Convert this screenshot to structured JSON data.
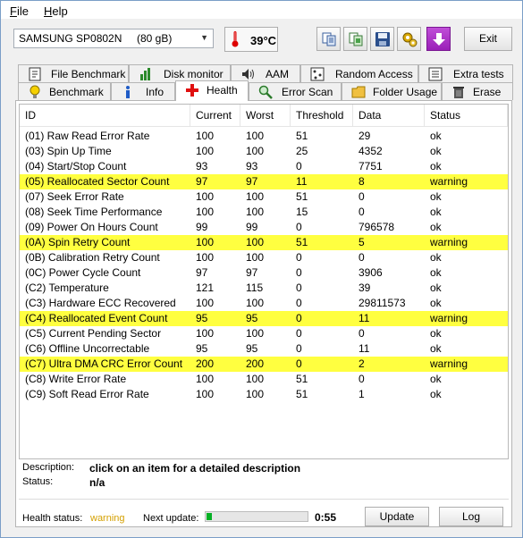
{
  "menu": {
    "file": "File",
    "help": "Help"
  },
  "toolbar": {
    "drive_name": "SAMSUNG SP0802N",
    "drive_size": "(80 gB)",
    "temperature": "39°C",
    "exit_label": "Exit"
  },
  "tabs_top": [
    "File Benchmark",
    "Disk monitor",
    "AAM",
    "Random Access",
    "Extra tests"
  ],
  "tabs_bottom": [
    "Benchmark",
    "Info",
    "Health",
    "Error Scan",
    "Folder Usage",
    "Erase"
  ],
  "active_tab": "Health",
  "table": {
    "headers": [
      "ID",
      "Current",
      "Worst",
      "Threshold",
      "Data",
      "Status"
    ],
    "rows": [
      {
        "id": "(01) Raw Read Error Rate",
        "current": "100",
        "worst": "100",
        "threshold": "51",
        "data": "29",
        "status": "ok",
        "warn": false
      },
      {
        "id": "(03) Spin Up Time",
        "current": "100",
        "worst": "100",
        "threshold": "25",
        "data": "4352",
        "status": "ok",
        "warn": false
      },
      {
        "id": "(04) Start/Stop Count",
        "current": "93",
        "worst": "93",
        "threshold": "0",
        "data": "7751",
        "status": "ok",
        "warn": false
      },
      {
        "id": "(05) Reallocated Sector Count",
        "current": "97",
        "worst": "97",
        "threshold": "11",
        "data": "8",
        "status": "warning",
        "warn": true
      },
      {
        "id": "(07) Seek Error Rate",
        "current": "100",
        "worst": "100",
        "threshold": "51",
        "data": "0",
        "status": "ok",
        "warn": false
      },
      {
        "id": "(08) Seek Time Performance",
        "current": "100",
        "worst": "100",
        "threshold": "15",
        "data": "0",
        "status": "ok",
        "warn": false
      },
      {
        "id": "(09) Power On Hours Count",
        "current": "99",
        "worst": "99",
        "threshold": "0",
        "data": "796578",
        "status": "ok",
        "warn": false
      },
      {
        "id": "(0A) Spin Retry Count",
        "current": "100",
        "worst": "100",
        "threshold": "51",
        "data": "5",
        "status": "warning",
        "warn": true
      },
      {
        "id": "(0B) Calibration Retry Count",
        "current": "100",
        "worst": "100",
        "threshold": "0",
        "data": "0",
        "status": "ok",
        "warn": false
      },
      {
        "id": "(0C) Power Cycle Count",
        "current": "97",
        "worst": "97",
        "threshold": "0",
        "data": "3906",
        "status": "ok",
        "warn": false
      },
      {
        "id": "(C2) Temperature",
        "current": "121",
        "worst": "115",
        "threshold": "0",
        "data": "39",
        "status": "ok",
        "warn": false
      },
      {
        "id": "(C3) Hardware ECC Recovered",
        "current": "100",
        "worst": "100",
        "threshold": "0",
        "data": "29811573",
        "status": "ok",
        "warn": false
      },
      {
        "id": "(C4) Reallocated Event Count",
        "current": "95",
        "worst": "95",
        "threshold": "0",
        "data": "11",
        "status": "warning",
        "warn": true
      },
      {
        "id": "(C5) Current Pending Sector",
        "current": "100",
        "worst": "100",
        "threshold": "0",
        "data": "0",
        "status": "ok",
        "warn": false
      },
      {
        "id": "(C6) Offline Uncorrectable",
        "current": "95",
        "worst": "95",
        "threshold": "0",
        "data": "11",
        "status": "ok",
        "warn": false
      },
      {
        "id": "(C7) Ultra DMA CRC Error Count",
        "current": "200",
        "worst": "200",
        "threshold": "0",
        "data": "2",
        "status": "warning",
        "warn": true
      },
      {
        "id": "(C8) Write Error Rate",
        "current": "100",
        "worst": "100",
        "threshold": "51",
        "data": "0",
        "status": "ok",
        "warn": false
      },
      {
        "id": "(C9) Soft Read Error Rate",
        "current": "100",
        "worst": "100",
        "threshold": "51",
        "data": "1",
        "status": "ok",
        "warn": false
      }
    ]
  },
  "description": {
    "desc_label": "Description:",
    "desc_value": "click on an item for a detailed description",
    "status_label": "Status:",
    "status_value": "n/a"
  },
  "footer": {
    "health_label": "Health status:",
    "health_value": "warning",
    "next_update_label": "Next update:",
    "progress": 0.05,
    "timer": "0:55",
    "update_label": "Update",
    "log_label": "Log"
  },
  "colors": {
    "warning_row": "#ffff40",
    "warning_text": "#d4a000",
    "progress": "#06b025"
  }
}
